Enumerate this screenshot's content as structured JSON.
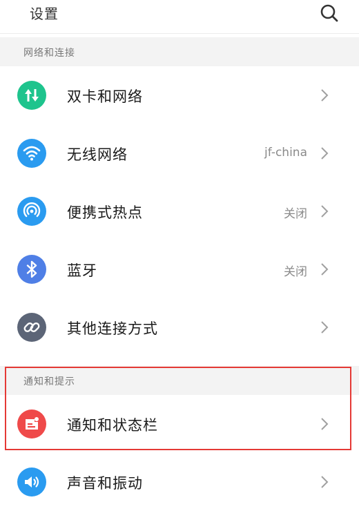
{
  "header": {
    "title": "设置"
  },
  "sections": [
    {
      "label": "网络和连接"
    },
    {
      "label": "通知和提示"
    }
  ],
  "rows": [
    {
      "label": "双卡和网络",
      "value": "",
      "icon": "dual-sim-icon",
      "color": "#1ec48d"
    },
    {
      "label": "无线网络",
      "value": "jf-china",
      "icon": "wifi-icon",
      "color": "#2a9bf0"
    },
    {
      "label": "便携式热点",
      "value": "关闭",
      "icon": "hotspot-icon",
      "color": "#2a9bf0"
    },
    {
      "label": "蓝牙",
      "value": "关闭",
      "icon": "bluetooth-icon",
      "color": "#4f7fe6"
    },
    {
      "label": "其他连接方式",
      "value": "",
      "icon": "link-icon",
      "color": "#5c6577"
    },
    {
      "label": "通知和状态栏",
      "value": "",
      "icon": "notification-icon",
      "color": "#ef4a4a"
    },
    {
      "label": "声音和振动",
      "value": "",
      "icon": "sound-icon",
      "color": "#2a9bf0"
    }
  ],
  "colors": {
    "highlight": "#e53935",
    "section_bg": "#f3f3f3",
    "chevron": "#a0a0a0"
  }
}
